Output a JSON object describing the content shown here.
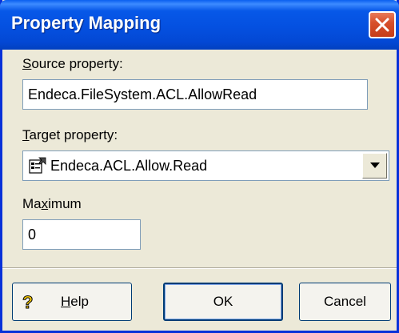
{
  "dialog": {
    "title": "Property Mapping",
    "close_icon": "close-icon"
  },
  "source": {
    "label_accel": "S",
    "label_rest": "ource property:",
    "value": "Endeca.FileSystem.ACL.AllowRead"
  },
  "target": {
    "label_accel": "T",
    "label_rest": "arget property:",
    "value": "Endeca.ACL.Allow.Read",
    "icon": "property-icon",
    "dropdown_icon": "dropdown-arrow-icon"
  },
  "maximum": {
    "label_pre": "Ma",
    "label_accel": "x",
    "label_post": "imum",
    "value": "0"
  },
  "buttons": {
    "help_accel": "H",
    "help_rest": "elp",
    "help_icon": "question-mark-icon",
    "ok": "OK",
    "cancel": "Cancel"
  },
  "colors": {
    "title_bar": "#0450e0",
    "close_button": "#d8502c",
    "dialog_bg": "#ece9d8"
  }
}
